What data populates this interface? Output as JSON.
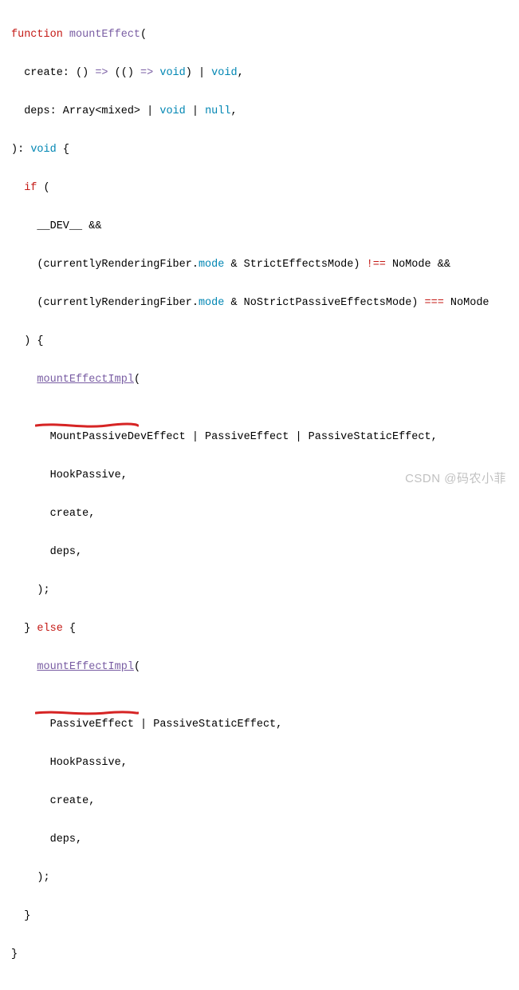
{
  "code": {
    "l1_kw": "function",
    "l1_fn": "mountEffect",
    "l1_tail": "(",
    "l2_param": "  create: () ",
    "l2_arrow": "=>",
    "l2_mid": " (() ",
    "l2_arrow2": "=>",
    "l2_sp": " ",
    "l2_void1": "void",
    "l2_pipe": ") | ",
    "l2_void2": "void",
    "l2_tail": ",",
    "l3_a": "  deps: Array<mixed> | ",
    "l3_void": "void",
    "l3_b": " | ",
    "l3_null": "null",
    "l3_tail": ",",
    "l4_a": "): ",
    "l4_void": "void",
    "l4_b": " {",
    "l5_if": "  if",
    "l5_b": " (",
    "l6": "    __DEV__ &&",
    "l7_a": "    (currentlyRenderingFiber.",
    "l7_mode": "mode",
    "l7_b": " & StrictEffectsMode) ",
    "l7_op": "!==",
    "l7_c": " NoMode &&",
    "l8_a": "    (currentlyRenderingFiber.",
    "l8_mode": "mode",
    "l8_b": " & NoStrictPassiveEffectsMode) ",
    "l8_op": "===",
    "l8_c": " NoMode",
    "l9": "  ) {",
    "l10_a": "    ",
    "l10_fn": "mountEffectImpl",
    "l10_b": "(",
    "l11": "      MountPassiveDevEffect | PassiveEffect | PassiveStaticEffect,",
    "l12": "      HookPassive,",
    "l13": "      create,",
    "l14": "      deps,",
    "l15": "    );",
    "l16_a": "  } ",
    "l16_else": "else",
    "l16_b": " {",
    "l17_a": "    ",
    "l17_fn": "mountEffectImpl",
    "l17_b": "(",
    "l18": "      PassiveEffect | PassiveStaticEffect,",
    "l19": "      HookPassive,",
    "l20": "      create,",
    "l21": "      deps,",
    "l22": "    );",
    "l23": "  }",
    "l24": "}"
  },
  "watermark": "CSDN @码农小菲"
}
